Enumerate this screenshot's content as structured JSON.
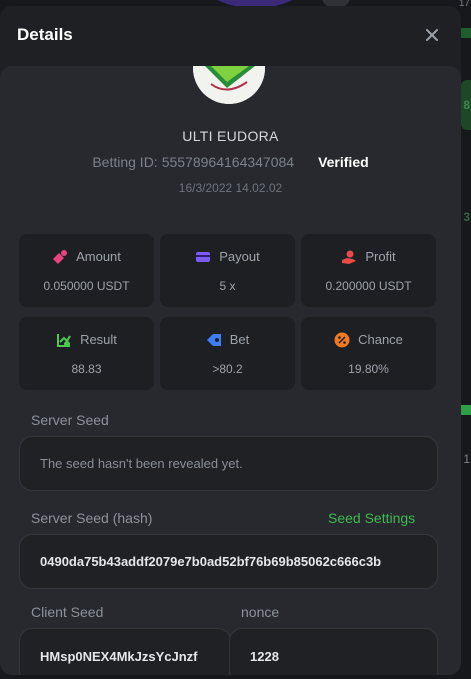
{
  "modal": {
    "title": "Details"
  },
  "player": {
    "username": "ULTI EUDORA",
    "betting_id_label": "Betting ID:",
    "betting_id": "55578964164347084",
    "verified": "Verified",
    "date": "16/3/2022 14.02.02"
  },
  "stats": [
    {
      "label": "Amount",
      "value": "0.050000 USDT",
      "icon": "coins-icon",
      "color": "#e8457f"
    },
    {
      "label": "Payout",
      "value": "5 x",
      "icon": "card-icon",
      "color": "#7c5cf5"
    },
    {
      "label": "Profit",
      "value": "0.200000 USDT",
      "icon": "hand-coin-icon",
      "color": "#e84a4a"
    },
    {
      "label": "Result",
      "value": "88.83",
      "icon": "chart-check-icon",
      "color": "#4cc94e"
    },
    {
      "label": "Bet",
      "value": ">80.2",
      "icon": "tag-icon",
      "color": "#3d7df5"
    },
    {
      "label": "Chance",
      "value": "19.80%",
      "icon": "percent-icon",
      "color": "#f07a21"
    }
  ],
  "server_seed": {
    "label": "Server Seed",
    "placeholder": "The seed hasn't been revealed yet."
  },
  "server_seed_hash": {
    "label": "Server Seed (hash)",
    "settings_link": "Seed Settings",
    "value": "0490da75b43addf2079e7b0ad52bf76b69b85062c666c3b"
  },
  "client_seed": {
    "label": "Client Seed",
    "value": "HMsp0NEX4MkJzsYcJnzf"
  },
  "nonce": {
    "label": "nonce",
    "value": "1228"
  },
  "background": {
    "side_labels": [
      "17",
      "8",
      "3",
      "1"
    ]
  }
}
